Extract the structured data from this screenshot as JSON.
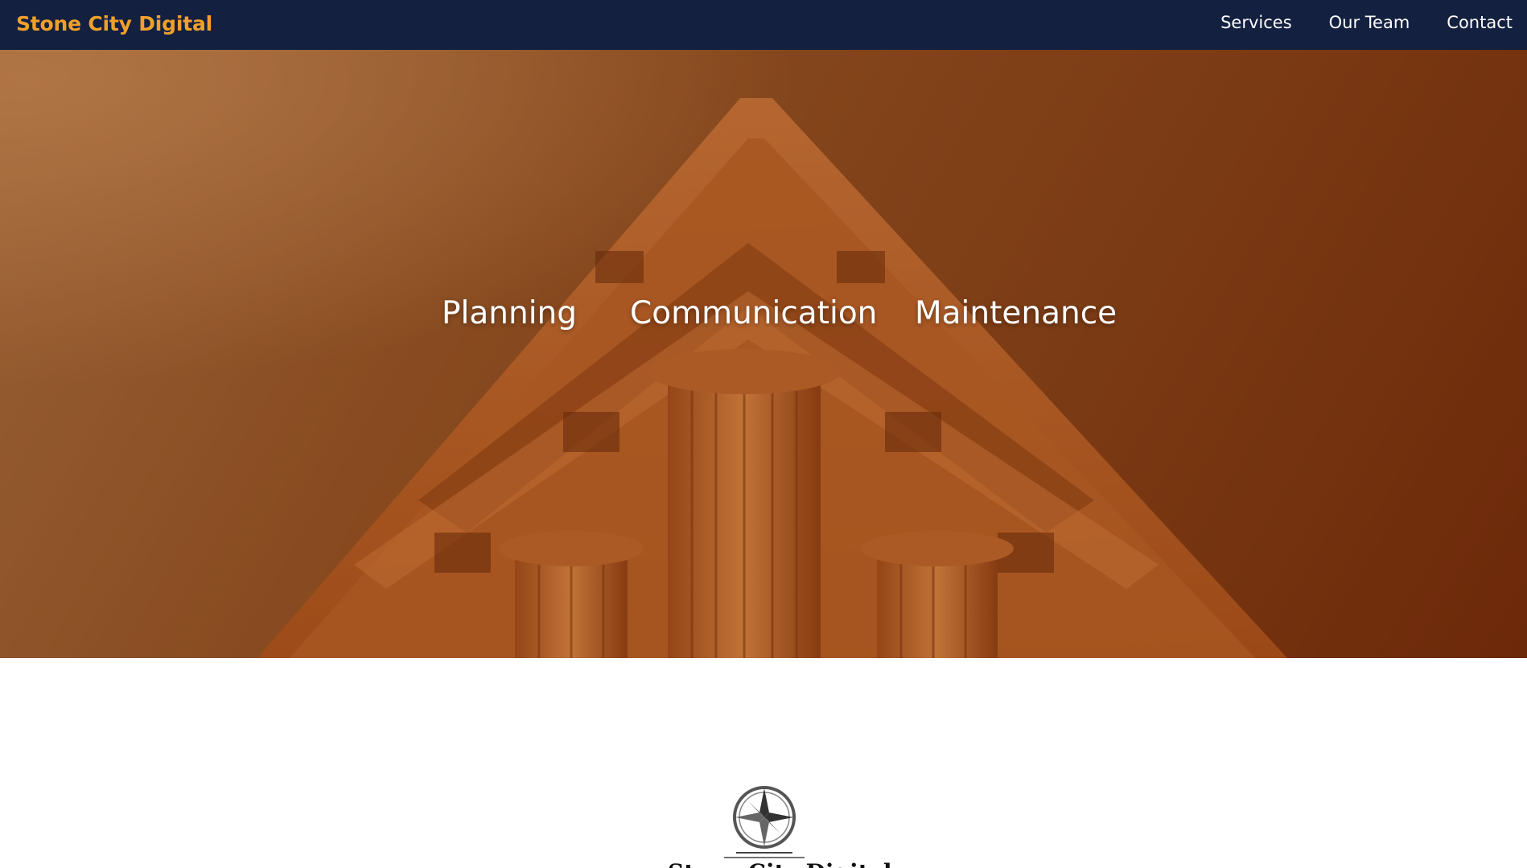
{
  "nav": {
    "brand": "Stone City Digital",
    "links": [
      "Services",
      "Our Team",
      "Contact"
    ]
  },
  "hero": {
    "words": [
      "Planning",
      "Communication",
      "Maintenance"
    ]
  },
  "logo": {
    "text": "Stone City Digital",
    "icon": "compass-rose-icon"
  },
  "colors": {
    "nav_bg": "#132040",
    "brand": "#f0a02a",
    "hero_tint": "#8a4d22"
  }
}
